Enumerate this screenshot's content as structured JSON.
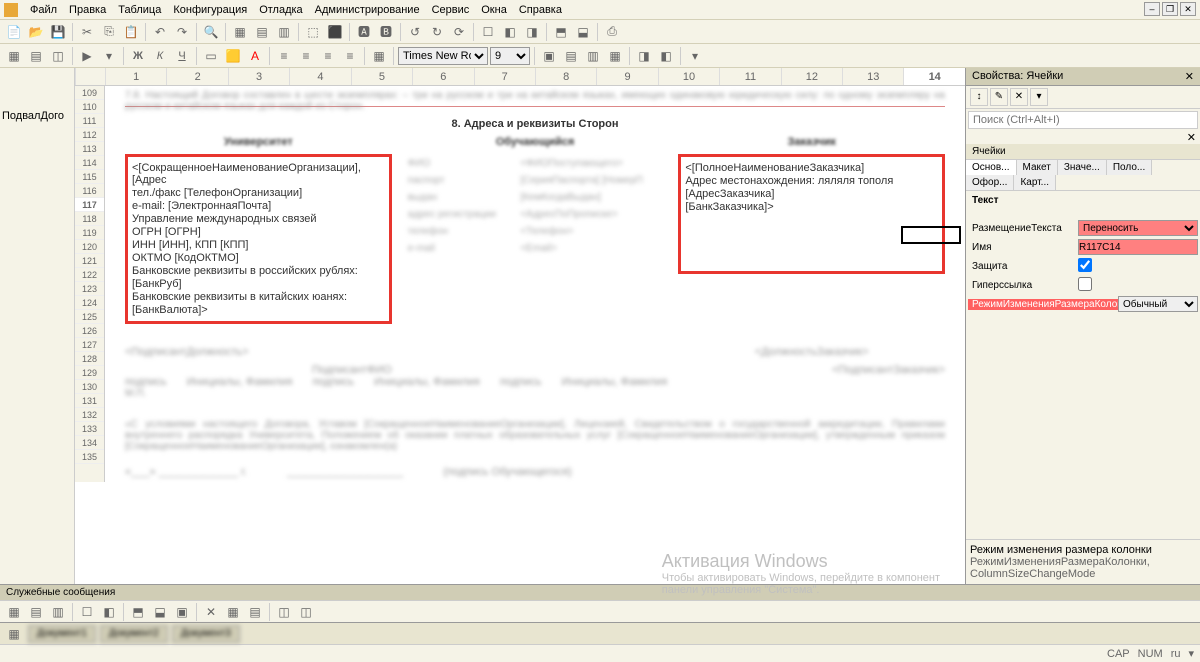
{
  "menu": {
    "items": [
      "Файл",
      "Правка",
      "Таблица",
      "Конфигурация",
      "Отладка",
      "Администрирование",
      "Сервис",
      "Окна",
      "Справка"
    ]
  },
  "window_buttons": [
    "–",
    "❐",
    "✕"
  ],
  "toolbar2": {
    "font": "Times New Roman",
    "size": "9"
  },
  "ruler": [
    "1",
    "2",
    "3",
    "4",
    "5",
    "6",
    "7",
    "8",
    "9",
    "10",
    "11",
    "12",
    "13",
    "14"
  ],
  "active_col": "14",
  "rows": [
    "109",
    "110",
    "111",
    "112",
    "113",
    "114",
    "115",
    "116",
    "117",
    "118",
    "119",
    "120",
    "121",
    "122",
    "123",
    "124",
    "125",
    "126",
    "127",
    "128",
    "129",
    "130",
    "131",
    "132",
    "133",
    "134",
    "135"
  ],
  "left_label": "ПодвалДого",
  "doc": {
    "para_top": "7.8. Настоящий Договор составлен в шести экземплярах: – три на русском и три на китайском языках, имеющих одинаковую юридическую силу: по одному экземпляру на русском и китайском языках для каждой из Сторон.",
    "section": "8. Адреса и реквизиты Сторон",
    "col1_title": "Университет",
    "col2_title": "Обучающийся",
    "col3_title": "Заказчик",
    "left_lines": [
      "<[СокращенноеНаименованиеОрганизации], [Адрес",
      "тел./факс [ТелефонОрганизации]",
      "e-mail: [ЭлектроннаяПочта]",
      "Управление международных связей",
      "ОГРН [ОГРН]",
      "ИНН [ИНН], КПП [КПП]",
      "ОКТМО [КодОКТМО]",
      "Банковские реквизиты в российских рублях:",
      "[БанкРуб]",
      "Банковские реквизиты в китайских юанях:",
      "[БанкВалюта]>"
    ],
    "mid_rows": [
      [
        "ФИО",
        "<ФИОПоступающего>"
      ],
      [
        "паспорт",
        "[СерияПаспорта] [НомерП"
      ],
      [
        "выдан",
        "[КемКогдаВыдан]"
      ],
      [
        "адрес регистрации",
        "<АдресПоПрописке>"
      ],
      [
        "телефон",
        "<Телефон>"
      ],
      [
        "e-mail",
        "<Email>"
      ]
    ],
    "right_lines": [
      "<[ПолноеНаименованиеЗаказчика]",
      "Адрес местонахождения: ляляля тополя",
      "[АдресЗаказчика]",
      "[БанкЗаказчика]>"
    ],
    "sign_l": "<ПодписантДолжность>",
    "sign_r": "<ДолжностьЗаказчик>",
    "sig_fio_l": "ПодписантФИО",
    "sig_fio_r": "<ПодписантЗаказчик>",
    "sig_row": [
      "подпись",
      "Инициалы, Фамилия",
      "подпись",
      "Инициалы, Фамилия",
      "подпись",
      "Инициалы, Фамилия"
    ],
    "mp": "М.П.",
    "bottom_para": "«С условиями настоящего Договора, Уставом [СокращенноеНаименованиеОрганизации], Лицензией, Свидетельством о государственной аккредитации, Правилами внутреннего распорядка Университета, Положением об оказании платных образовательных услуг [СокращенноеНаименованиеОрганизации], утвержденным приказом [СокращенноеНаименованиеОрганизации], ознакомлен(а)",
    "sig_stud": "(подпись Обучающегося)",
    "date_line": "«___» _____________ г."
  },
  "panel": {
    "title": "Свойства: Ячейки",
    "search_ph": "Поиск (Ctrl+Alt+I)",
    "hdr": "Ячейки",
    "tabs": [
      "Основ...",
      "Макет",
      "Значе...",
      "Поло...",
      "Офор...",
      "Карт..."
    ],
    "active_tab": "Основ...",
    "group": "Текст",
    "props": {
      "placement_label": "РазмещениеТекста",
      "placement_val": "Переносить",
      "name_label": "Имя",
      "name_val": "R117C14",
      "protect_label": "Защита",
      "protect_val": true,
      "link_label": "Гиперссылка",
      "link_val": "",
      "mode_label": "РежимИзмененияРазмераКолонки",
      "mode_val": "Обычный"
    },
    "desc_title": "Режим изменения размера колонки",
    "desc_text": "РежимИзмененияРазмераКолонки, ColumnSizeChangeMode"
  },
  "bottom_bar": "Служебные сообщения",
  "watermark": {
    "big": "Активация Windows",
    "small1": "Чтобы активировать Windows, перейдите в компонент",
    "small2": "панели управления \"Система\"."
  },
  "status": [
    "CAP",
    "NUM",
    "ru",
    "▾"
  ]
}
